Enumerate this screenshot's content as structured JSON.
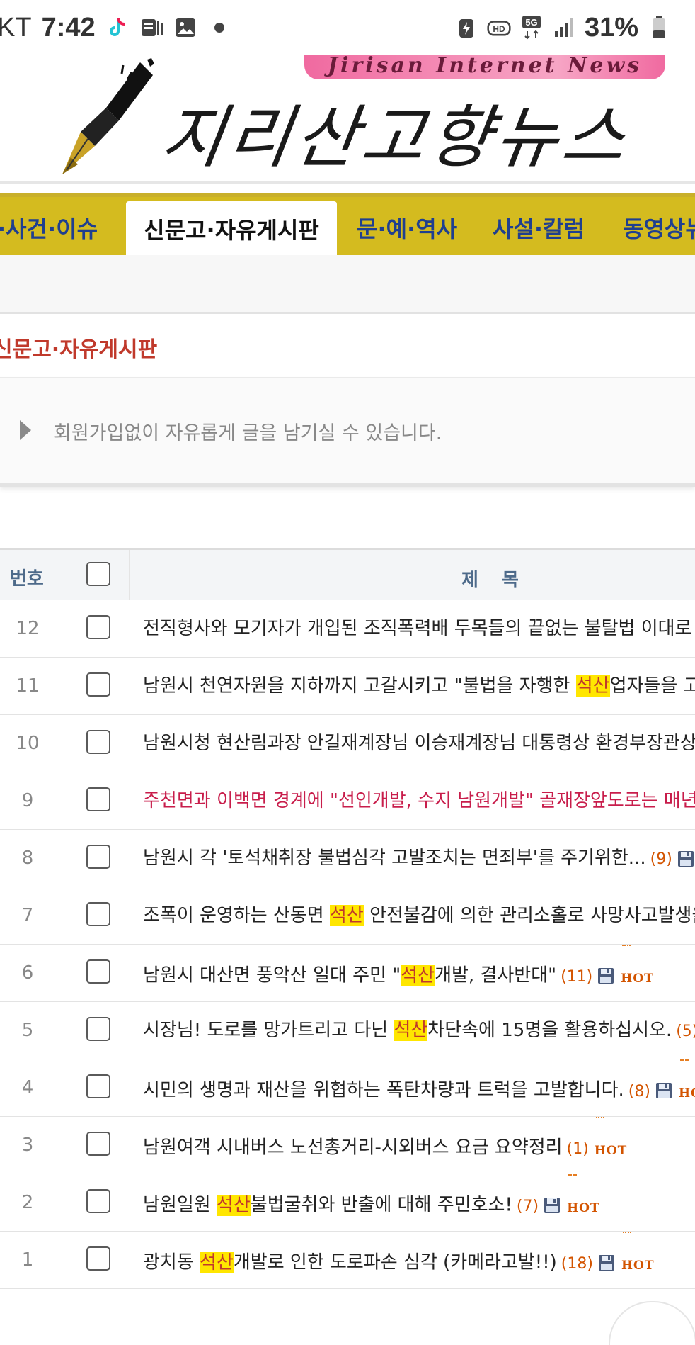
{
  "status_bar": {
    "carrier": "KT",
    "time": "7:42",
    "battery_pct": "31%"
  },
  "banner": {
    "site_name": "지리산고향뉴스",
    "tagline": "Jirisan Internet News"
  },
  "nav": {
    "items": [
      {
        "label": "·사건·이슈"
      },
      {
        "label": "신문고·자유게시판",
        "active": true
      },
      {
        "label": "문·예·역사"
      },
      {
        "label": "사설·칼럼"
      },
      {
        "label": "동영상뉴"
      }
    ]
  },
  "page": {
    "title": "신문고·자유게시판",
    "notice": "회원가입없이 자유롭게 글을 남기실 수 있습니다."
  },
  "table": {
    "headers": {
      "num": "번호",
      "title": "제  목"
    },
    "rows": [
      {
        "num": "12",
        "parts": [
          "전직형사와 모기자가 개입된 조직폭력배 두목들의 끝없는 불탈법 이대로 "
        ],
        "comments": "",
        "file": false,
        "hot": false,
        "red": false
      },
      {
        "num": "11",
        "parts": [
          "남원시 천연자원을 지하까지 고갈시키고 \"불법을 자행한 ",
          "석산",
          "업자들을 고"
        ],
        "comments": "",
        "file": false,
        "hot": false,
        "red": false
      },
      {
        "num": "10",
        "parts": [
          "남원시청 현산림과장 안길재계장님 이승재계장님 대통령상 환경부장관상"
        ],
        "comments": "",
        "file": false,
        "hot": false,
        "red": false
      },
      {
        "num": "9",
        "parts": [
          "주천면과 이백면 경계에 \"선인개발, 수지 남원개발\" 골재장앞도로는 매년당"
        ],
        "comments": "",
        "file": false,
        "hot": false,
        "red": true
      },
      {
        "num": "8",
        "parts": [
          "남원시 각 '토석채취장 불법심각 고발조치는 면죄부'를 주기위한..."
        ],
        "comments": "(9)",
        "file": true,
        "hot": false,
        "red": false
      },
      {
        "num": "7",
        "parts": [
          "조폭이 운영하는 산동면 ",
          "석산",
          " 안전불감에 의한 관리소홀로 사망사고발생을"
        ],
        "comments": "",
        "file": false,
        "hot": false,
        "red": false
      },
      {
        "num": "6",
        "parts": [
          "남원시 대산면 풍악산 일대 주민 \"",
          "석산",
          "개발, 결사반대\""
        ],
        "comments": "(11)",
        "file": true,
        "hot": true,
        "red": false
      },
      {
        "num": "5",
        "parts": [
          "시장님! 도로를 망가트리고 다닌 ",
          "석산",
          "차단속에 15명을 활용하십시오."
        ],
        "comments": "(5)",
        "file": false,
        "hot": false,
        "red": false
      },
      {
        "num": "4",
        "parts": [
          "시민의 생명과 재산을 위협하는 폭탄차량과 트럭을 고발합니다."
        ],
        "comments": "(8)",
        "file": true,
        "hot": true,
        "red": false
      },
      {
        "num": "3",
        "parts": [
          "남원여객 시내버스 노선총거리-시외버스 요금 요약정리"
        ],
        "comments": "(1)",
        "file": false,
        "hot": true,
        "red": false
      },
      {
        "num": "2",
        "parts": [
          "남원일원 ",
          "석산",
          "불법굴취와 반출에 대해 주민호소!"
        ],
        "comments": "(7)",
        "file": true,
        "hot": true,
        "red": false
      },
      {
        "num": "1",
        "parts": [
          "광치동 ",
          "석산",
          "개발로 인한 도로파손 심각 (카메라고발!!)"
        ],
        "comments": "(18)",
        "file": true,
        "hot": true,
        "red": false
      }
    ],
    "hot_label": "HOT"
  },
  "colors": {
    "nav_bg": "#d4bb1f",
    "nav_text": "#1f3f8f",
    "title_red": "#c0392b",
    "highlight": "#ffe600",
    "comment": "#d35400"
  }
}
